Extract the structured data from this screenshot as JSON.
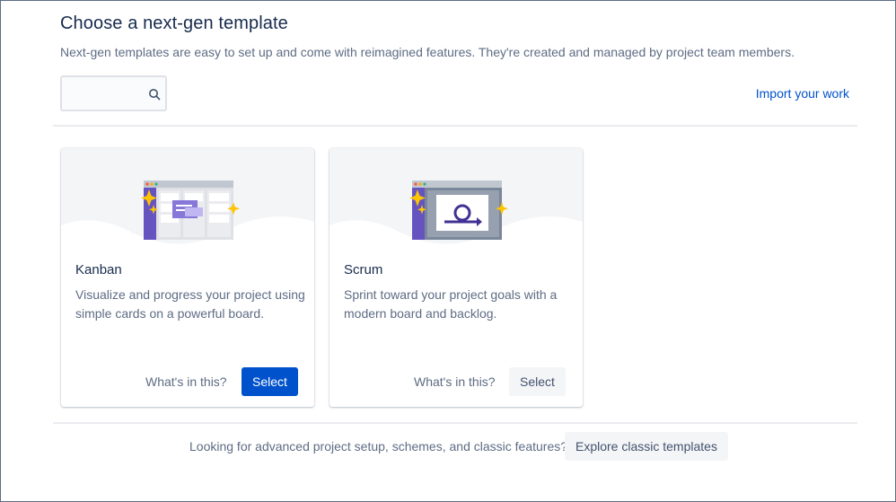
{
  "header": {
    "title": "Choose a next-gen template",
    "subtitle": "Next-gen templates are easy to set up and come with reimagined features. They're created and managed by project team members."
  },
  "search": {
    "value": "",
    "placeholder": "",
    "icon": "search-icon"
  },
  "import_link": "Import your work",
  "templates": [
    {
      "name": "Kanban",
      "description": "Visualize and progress your project using simple cards on a powerful board.",
      "whats_in_label": "What's in this?",
      "select_label": "Select",
      "selected": true
    },
    {
      "name": "Scrum",
      "description": "Sprint toward your project goals with a modern board and backlog.",
      "whats_in_label": "What's in this?",
      "select_label": "Select",
      "selected": false
    }
  ],
  "footer": {
    "text": "Looking for advanced project setup, schemes, and classic features?",
    "button_label": "Explore classic templates"
  },
  "colors": {
    "primary": "#0052cc",
    "text": "#172b4d",
    "subtle_text": "#5e6c84",
    "hero_bg": "#f4f5f7",
    "illustration_purple": "#6554c0",
    "sparkle": "#ffc400"
  }
}
